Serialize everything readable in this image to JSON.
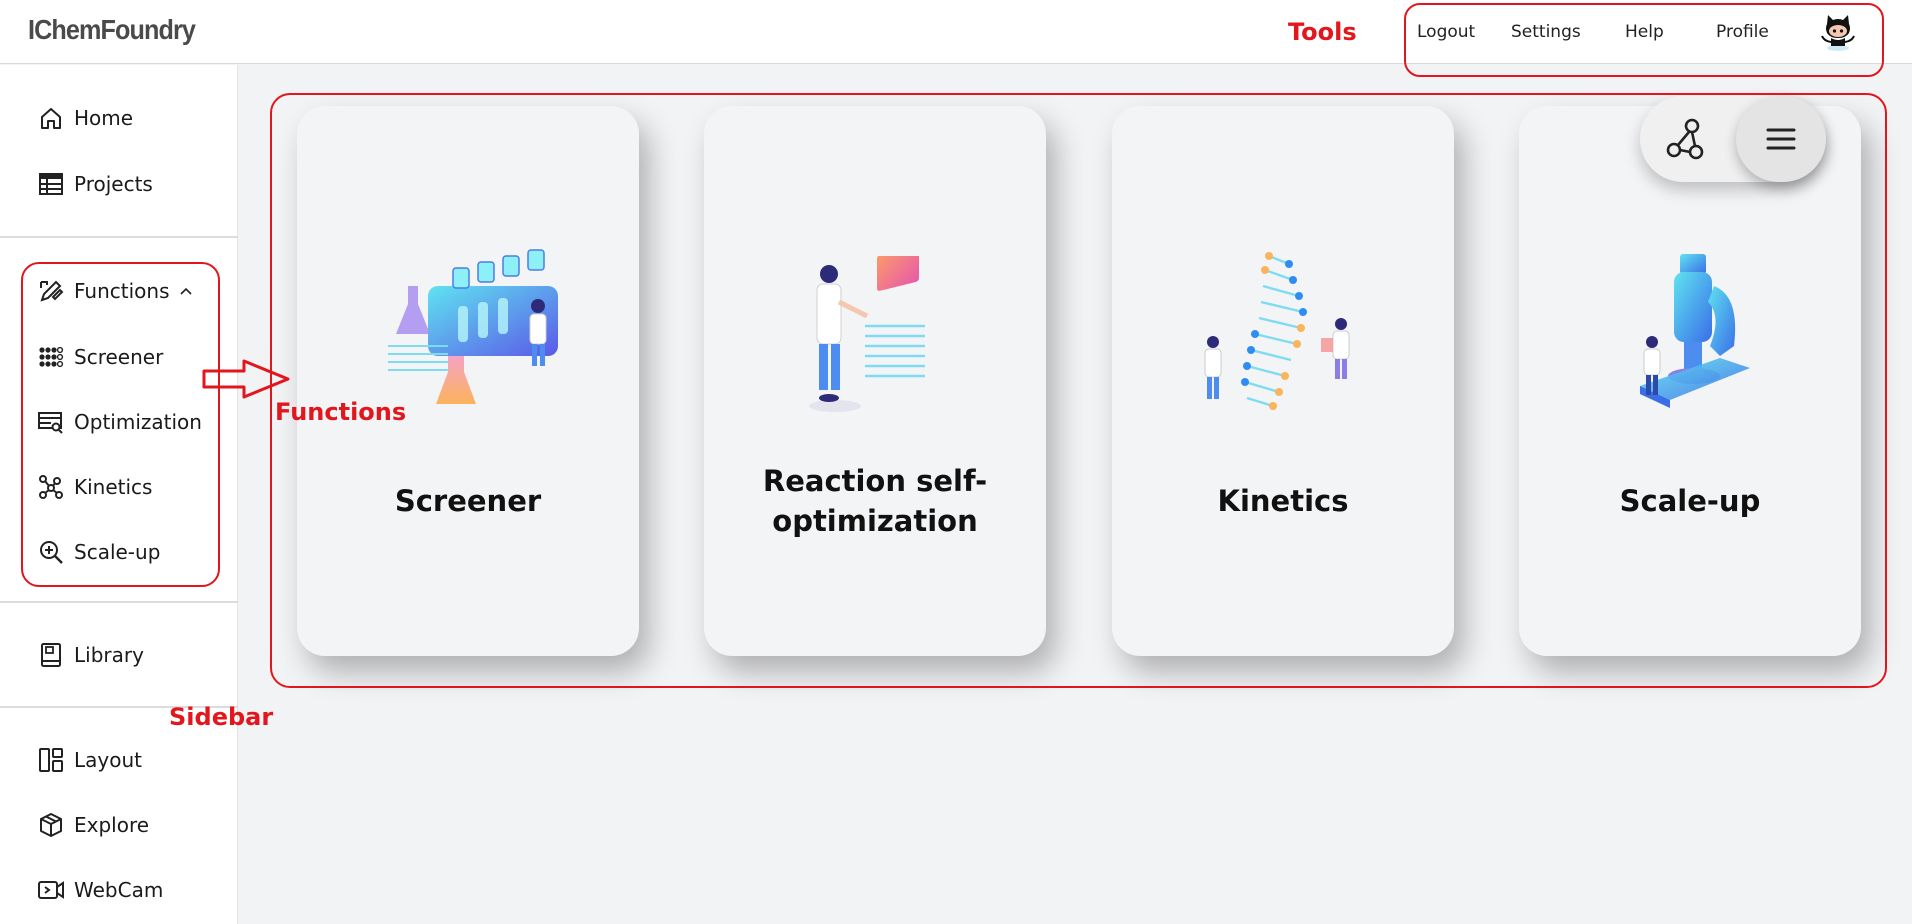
{
  "app": {
    "title": "IChemFoundry"
  },
  "header": {
    "links": [
      {
        "key": "logout",
        "label": "Logout"
      },
      {
        "key": "settings",
        "label": "Settings"
      },
      {
        "key": "help",
        "label": "Help"
      },
      {
        "key": "profile",
        "label": "Profile"
      }
    ],
    "avatar_icon": "github-octocat-icon"
  },
  "sidebar": {
    "home": "Home",
    "projects": "Projects",
    "functions": "Functions",
    "screener": "Screener",
    "optimization": "Optimization",
    "kinetics": "Kinetics",
    "scaleup": "Scale-up",
    "library": "Library",
    "layout": "Layout",
    "explore": "Explore",
    "webcam": "WebCam"
  },
  "cards": [
    {
      "title": "Screener"
    },
    {
      "title_line1": "Reaction self-",
      "title_line2": "optimization"
    },
    {
      "title": "Kinetics"
    },
    {
      "title": "Scale-up"
    }
  ],
  "annotations": {
    "tools": "Tools",
    "functions": "Functions",
    "sidebar": "Sidebar",
    "color": "#e2161d"
  },
  "toolbar": {
    "graph_icon": "molecule-graph-icon",
    "menu_icon": "hamburger-menu-icon"
  }
}
